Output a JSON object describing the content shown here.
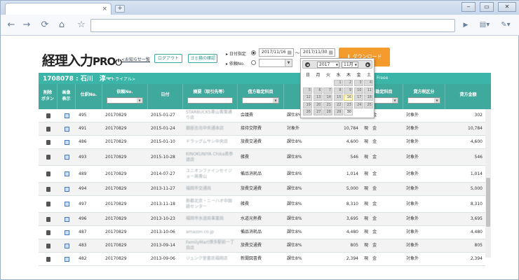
{
  "browser": {
    "tab_close": "×",
    "new_tab": "+",
    "minimize": "‒",
    "maximize": "▭",
    "close": "✕"
  },
  "header": {
    "logo_main": "経理入力",
    "logo_pro": "PRO",
    "notice_link": "<お知らせ一覧",
    "logout": "ログアウト",
    "trash_confirm": "ゴミ箱の確認",
    "date_label": "日付指定",
    "date_from": "2017/11/16",
    "date_sep": "～",
    "date_to": "2017/11/30",
    "slip_label": "依頼No.",
    "download": "ダウンロード"
  },
  "customer": {
    "id_name": "1708078 : 石川　淳一",
    "trial": "<トライアル>",
    "free": "Freee"
  },
  "columns": [
    {
      "label": "削除\nボタン"
    },
    {
      "label": "画像\n表示"
    },
    {
      "label": "仕訳No."
    },
    {
      "label": "依頼No."
    },
    {
      "label": "日付"
    },
    {
      "label": "摘要（取引先等）"
    },
    {
      "label": "借方勘定科目"
    },
    {
      "label": "借"
    },
    {
      "label": ""
    },
    {
      "label": "方勘定科目"
    },
    {
      "label": "貸方税区分"
    },
    {
      "label": "貸方金額"
    }
  ],
  "calendar": {
    "prev": "◀",
    "next": "▶",
    "year": "2017",
    "month": "11月",
    "dow": [
      "日",
      "月",
      "火",
      "水",
      "木",
      "金",
      "土"
    ],
    "weeks": [
      [
        "",
        "",
        "",
        "1",
        "2",
        "3",
        "4"
      ],
      [
        "5",
        "6",
        "7",
        "8",
        "9",
        "10",
        "11"
      ],
      [
        "12",
        "13",
        "14",
        "15",
        "16",
        "17",
        "18"
      ],
      [
        "19",
        "20",
        "21",
        "22",
        "23",
        "24",
        "25"
      ],
      [
        "26",
        "27",
        "28",
        "29",
        "30",
        "",
        ""
      ]
    ],
    "today": "16"
  },
  "rows": [
    {
      "no": "495",
      "req": "20170829",
      "date": "2015-01-27",
      "memo": "STARBUCKS青山青葉通り店",
      "acct": "会議費",
      "tax": "課仕8%",
      "amt": "302",
      "cred": "現　金",
      "ctax": "対象外",
      "camt": "302"
    },
    {
      "no": "491",
      "req": "20170829",
      "date": "2015-01-24",
      "memo": "銀座吉兆中央通本店",
      "acct": "接待交際費",
      "tax": "対象外",
      "amt": "10,784",
      "cred": "現　金",
      "ctax": "対象外",
      "camt": "10,784"
    },
    {
      "no": "486",
      "req": "20170829",
      "date": "2015-01-10",
      "memo": "ドラッグムサシ中央店",
      "acct": "旅費交通費",
      "tax": "課仕8%",
      "amt": "4,600",
      "cred": "現　金",
      "ctax": "対象外",
      "camt": "4,600"
    },
    {
      "no": "493",
      "req": "20170829",
      "date": "2015-10-28",
      "memo": "KINOKUNIYA Chika表参道店",
      "acct": "雑費",
      "tax": "課仕8%",
      "amt": "546",
      "cred": "現　金",
      "ctax": "対象外",
      "camt": "546"
    },
    {
      "no": "489",
      "req": "20170829",
      "date": "2014-07-27",
      "memo": "ユニオンファインセイジョー南青山",
      "acct": "備品消耗品",
      "tax": "課仕8%",
      "amt": "1,014",
      "cred": "現　金",
      "ctax": "対象外",
      "camt": "1,014"
    },
    {
      "no": "494",
      "req": "20170829",
      "date": "2013-11-27",
      "memo": "福岡市交通局",
      "acct": "旅費交通費",
      "tax": "課仕8%",
      "amt": "5,000",
      "cred": "現　金",
      "ctax": "対象外",
      "camt": "5,000"
    },
    {
      "no": "497",
      "req": "20170829",
      "date": "2013-11-18",
      "memo": "新都北京・ニーハオ中国語センター",
      "acct": "雑費",
      "tax": "課仕8%",
      "amt": "8,310",
      "cred": "現　金",
      "ctax": "対象外",
      "camt": "8,310"
    },
    {
      "no": "496",
      "req": "20170829",
      "date": "2013-10-23",
      "memo": "福岡市水道局事業局",
      "acct": "水道光熱費",
      "tax": "課仕8%",
      "amt": "3,695",
      "cred": "現　金",
      "ctax": "対象外",
      "camt": "3,695"
    },
    {
      "no": "487",
      "req": "20170829",
      "date": "2013-10-06",
      "memo": "amazon.co.jp",
      "acct": "備品消耗品",
      "tax": "課仕8%",
      "amt": "4,480",
      "cred": "現　金",
      "ctax": "対象外",
      "camt": "4,480"
    },
    {
      "no": "483",
      "req": "20170829",
      "date": "2013-09-14",
      "memo": "FamilyMart博多駅前一丁目店",
      "acct": "旅費交通費",
      "tax": "課仕8%",
      "amt": "805",
      "cred": "現　金",
      "ctax": "対象外",
      "camt": "805"
    },
    {
      "no": "482",
      "req": "20170829",
      "date": "2013-09-06",
      "memo": "ジュンク堂書店福岡店",
      "acct": "新聞図書費",
      "tax": "課仕8%",
      "amt": "2,394",
      "cred": "現　金",
      "ctax": "対象外",
      "camt": "2,394"
    }
  ]
}
